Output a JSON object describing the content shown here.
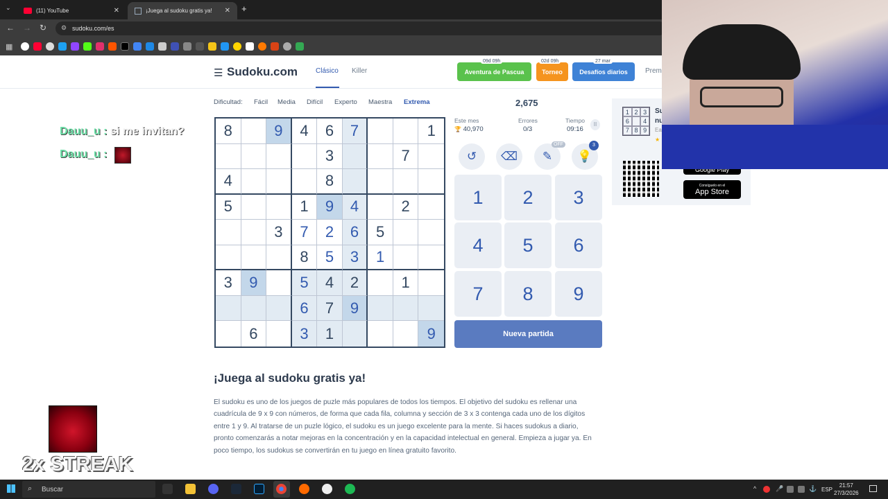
{
  "browser": {
    "tabs": [
      {
        "title": "(11) YouTube",
        "icon": "youtube-icon"
      },
      {
        "title": "¡Juega al sudoku gratis ya!",
        "icon": "sudoku-favicon-icon"
      }
    ],
    "new_tab": "+",
    "url": "sudoku.com/es"
  },
  "site": {
    "logo": "Sudoku.com",
    "nav": [
      "Clásico",
      "Killer"
    ],
    "promos": [
      {
        "tag": "09d 09h",
        "label": "Aventura de Pascua",
        "color": "#5ac24c"
      },
      {
        "tag": "02d 09h",
        "label": "Torneo",
        "color": "#f5941e"
      },
      {
        "tag": "27 mar",
        "label": "Desafíos diarios",
        "color": "#3e82d6"
      }
    ],
    "premium": "Prem"
  },
  "difficulty": {
    "label": "Dificultad:",
    "levels": [
      "Fácil",
      "Media",
      "Difícil",
      "Experto",
      "Maestra",
      "Extrema"
    ],
    "active": "Extrema"
  },
  "grid": [
    [
      "8",
      "",
      "9",
      "4",
      "6",
      "7",
      "",
      "",
      "1"
    ],
    [
      "",
      "",
      "",
      "",
      "3",
      "",
      "",
      "7",
      ""
    ],
    [
      "4",
      "",
      "",
      "",
      "8",
      "",
      "",
      "",
      ""
    ],
    [
      "5",
      "",
      "",
      "1",
      "9",
      "4",
      "",
      "2",
      ""
    ],
    [
      "",
      "",
      "3",
      "7",
      "2",
      "6",
      "5",
      "",
      ""
    ],
    [
      "",
      "",
      "",
      "8",
      "5",
      "3",
      "1",
      "",
      ""
    ],
    [
      "3",
      "9",
      "",
      "5",
      "4",
      "2",
      "",
      "1",
      ""
    ],
    [
      "",
      "",
      "",
      "6",
      "7",
      "9",
      "",
      "",
      ""
    ],
    [
      "",
      "6",
      "",
      "3",
      "1",
      "",
      "",
      "",
      "9"
    ]
  ],
  "game": {
    "score": "2,675",
    "month_label": "Este mes",
    "month_value": "40,970",
    "errors_label": "Errores",
    "errors_value": "0/3",
    "time_label": "Tiempo",
    "time_value": "09:16",
    "pencil_badge": "OFF",
    "hint_badge": "3",
    "numpad": [
      "1",
      "2",
      "3",
      "4",
      "5",
      "6",
      "7",
      "8",
      "9"
    ],
    "new_game": "Nueva partida"
  },
  "ad": {
    "mini_grid": [
      "1",
      "2",
      "3",
      "6",
      "",
      "4",
      "7",
      "8",
      "9"
    ],
    "google_play": "Google Play",
    "app_store_small": "Consíguelo en el",
    "app_store": "App Store",
    "text1": "Su",
    "text2": "nu",
    "text3": "Ea"
  },
  "article": {
    "title": "¡Juega al sudoku gratis ya!",
    "paragraph": "El sudoku es uno de los juegos de puzle más populares de todos los tiempos. El objetivo del sudoku es rellenar una cuadrícula de 9 x 9 con números, de forma que cada fila, columna y sección de 3 x 3 contenga cada uno de los dígitos entre 1 y 9. Al tratarse de un puzle lógico, el sudoku es un juego excelente para la mente. Si haces sudokus a diario, pronto comenzarás a notar mejoras en la concentración y en la capacidad intelectual en general. Empieza a jugar ya. En poco tiempo, los sudokus se convertirán en tu juego en línea gratuito favorito."
  },
  "overlay": {
    "chat": [
      {
        "user": "Dauu_u",
        "sep": " : ",
        "msg": "si me invitan?"
      },
      {
        "user": "Dauu_u",
        "sep": " : ",
        "msg": ""
      }
    ],
    "streak": "2x STREAK"
  },
  "taskbar": {
    "search": "Buscar",
    "lang": "ESP",
    "time": "21:57",
    "date": "27/3/2026"
  }
}
